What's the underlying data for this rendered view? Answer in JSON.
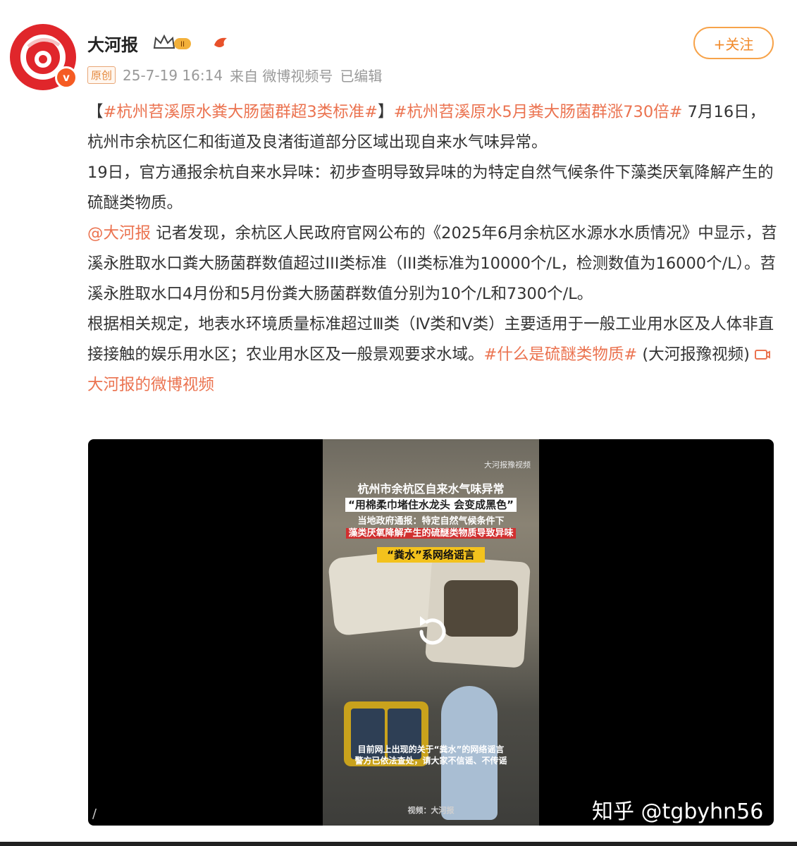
{
  "post": {
    "author": "大河报",
    "level_badge": "II",
    "follow_label": "+关注",
    "original_tag": "原创",
    "timestamp": "25-7-19 16:14",
    "source": "来自 微博视频号",
    "edited": "已编辑",
    "avatar_check": "v"
  },
  "content": {
    "bracket_open": "【",
    "tag1": "#杭州苕溪原水粪大肠菌群超3类标准#",
    "bracket_close": "】",
    "tag2": "#杭州苕溪原水5月粪大肠菌群涨730倍#",
    "p1_text": " 7月16日，杭州市余杭区仁和街道及良渚街道部分区域出现自来水气味异常。",
    "p2": "19日，官方通报余杭自来水异味：初步查明导致异味的为特定自然气候条件下藻类厌氧降解产生的硫醚类物质。",
    "mention": "@大河报",
    "p3_text": " 记者发现，余杭区人民政府官网公布的《2025年6月余杭区水源水水质情况》中显示，苕溪永胜取水口粪大肠菌群数值超过III类标准（III类标准为10000个/L，检测数值为16000个/L）。苕溪永胜取水口4月份和5月份粪大肠菌群数值分别为10个/L和7300个/L。",
    "p4_text": "根据相关规定，地表水环境质量标准超过Ⅲ类（Ⅳ类和Ⅴ类）主要适用于一般工业用水区及人体非直接接触的娱乐用水区；农业用水区及一般景观要求水域。",
    "tag3": "#什么是硫醚类物质#",
    "p4_suffix": " (大河报豫视频) ",
    "video_link": "大河报的微博视频"
  },
  "video": {
    "caption_title": "杭州市余杭区自来水气味异常",
    "caption_quote": "“用棉柔巾堵住水龙头 会变成黑色”",
    "caption_gov_1": "当地政府通报：特定自然气候条件下",
    "caption_gov_2": "藻类厌氧降解产生的硫醚类物质导致异味",
    "caption_rumor": "“粪水”系网络谣言",
    "caption_bottom_1": "目前网上出现的关于“粪水”的网络谣言",
    "caption_bottom_2": "警方已依法查处，请大家不信谣、不传谣",
    "caption_footer": "视频：大河报",
    "frame_logo": "大河报豫视频",
    "slash": "/"
  },
  "watermark": "知乎 @tgbyhn56",
  "colors": {
    "tag_link": "#eb7350",
    "follow_border": "#f7a34a",
    "avatar_red": "#e0262b"
  }
}
